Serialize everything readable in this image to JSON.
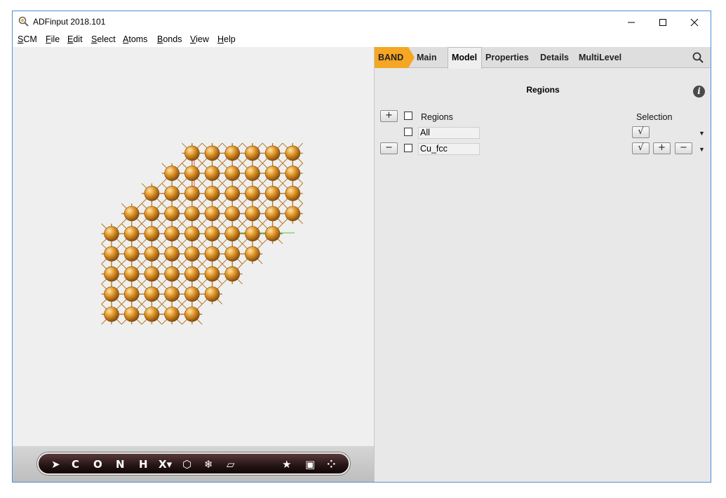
{
  "window": {
    "title": "ADFinput 2018.101"
  },
  "menubar": [
    "SCM",
    "File",
    "Edit",
    "Select",
    "Atoms",
    "Bonds",
    "View",
    "Help"
  ],
  "viewer": {
    "toolbar": {
      "tools": [
        {
          "name": "select-tool",
          "glyph": "➤"
        },
        {
          "name": "carbon-tool",
          "glyph": "C"
        },
        {
          "name": "oxygen-tool",
          "glyph": "O"
        },
        {
          "name": "nitrogen-tool",
          "glyph": "N"
        },
        {
          "name": "hydrogen-tool",
          "glyph": "H"
        },
        {
          "name": "other-element-tool",
          "glyph": "X▾"
        },
        {
          "name": "ring-tool",
          "glyph": "⬡"
        },
        {
          "name": "crystal-tool",
          "glyph": "❄"
        },
        {
          "name": "slab-tool",
          "glyph": "▱"
        },
        {
          "name": "favorites-tool",
          "glyph": "★"
        },
        {
          "name": "view-box-tool",
          "glyph": "▣"
        },
        {
          "name": "molecule-tool",
          "glyph": "⁘"
        }
      ]
    }
  },
  "panel": {
    "engine_tab": "BAND",
    "tabs": [
      "Main",
      "Model",
      "Properties",
      "Details",
      "MultiLevel"
    ],
    "active_tab": "Model",
    "section_title": "Regions",
    "columns": {
      "regions": "Regions",
      "selection": "Selection"
    },
    "rows": [
      {
        "name": "All"
      },
      {
        "name": "Cu_fcc"
      }
    ],
    "buttons": {
      "add": "+",
      "remove": "−",
      "check": "√"
    }
  },
  "colors": {
    "accent": "#f5a623",
    "atom": "#d68a1e",
    "bond": "#b7771c"
  }
}
